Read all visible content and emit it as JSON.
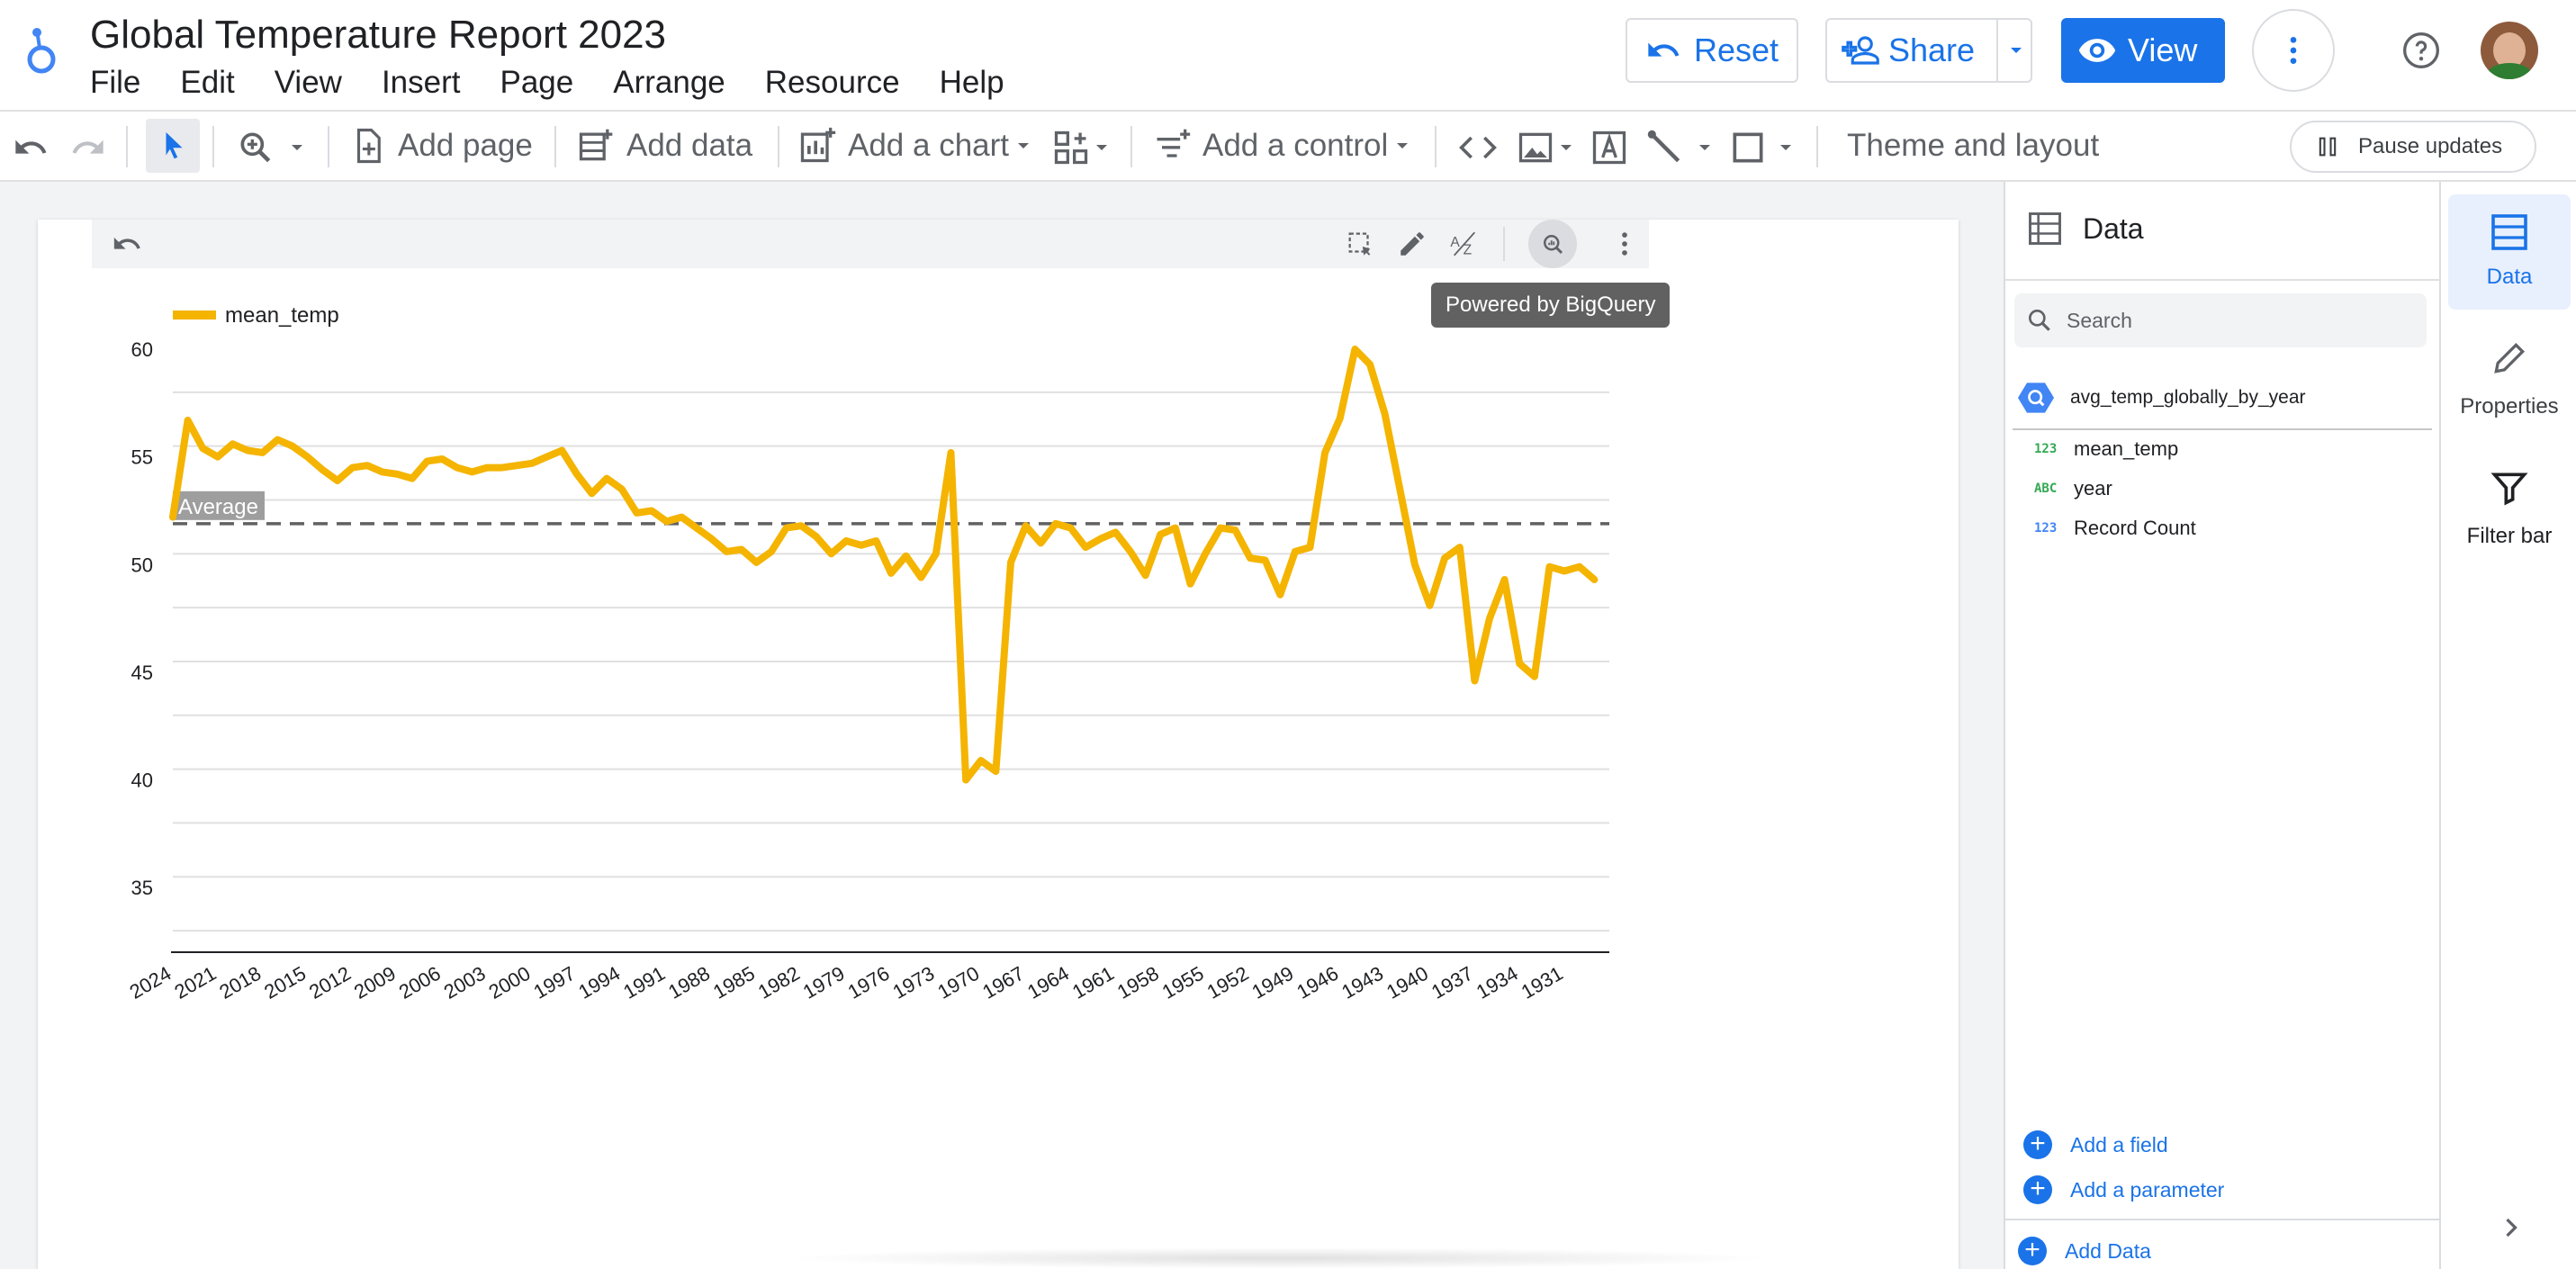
{
  "app": {
    "title": "Global Temperature Report 2023"
  },
  "menu": [
    "File",
    "Edit",
    "View",
    "Insert",
    "Page",
    "Arrange",
    "Resource",
    "Help"
  ],
  "header": {
    "reset_label": "Reset",
    "share_label": "Share",
    "view_label": "View"
  },
  "toolbar": {
    "add_page": "Add page",
    "add_data": "Add data",
    "add_chart": "Add a chart",
    "add_control": "Add a control",
    "theme_layout": "Theme and layout",
    "pause_updates": "Pause updates"
  },
  "tooltip": "Powered by BigQuery",
  "data_panel": {
    "title": "Data",
    "search_placeholder": "Search",
    "source": "avg_temp_globally_by_year",
    "fields": [
      {
        "type": "123",
        "name": "mean_temp",
        "type_color": "#34a853"
      },
      {
        "type": "ABC",
        "name": "year",
        "type_color": "#34a853"
      },
      {
        "type": "123",
        "name": "Record Count",
        "type_color": "#4285f4"
      }
    ],
    "add_field": "Add a field",
    "add_parameter": "Add a parameter",
    "add_data": "Add Data"
  },
  "side_tabs": {
    "data": "Data",
    "properties": "Properties",
    "filter_bar": "Filter bar"
  },
  "colors": {
    "accent": "#1a73e8",
    "series": "#f4b400",
    "reference_line": "#5f6368"
  },
  "chart_data": {
    "type": "line",
    "legend": [
      "mean_temp"
    ],
    "legend_position": "top-left",
    "ylim": [
      32,
      60
    ],
    "yticks": [
      35,
      40,
      45,
      50,
      55,
      60
    ],
    "grid": true,
    "reference_line": {
      "label": "Average",
      "value": 51.9
    },
    "x": [
      2024,
      2023,
      2022,
      2021,
      2020,
      2019,
      2018,
      2017,
      2016,
      2015,
      2014,
      2013,
      2012,
      2011,
      2010,
      2009,
      2008,
      2007,
      2006,
      2005,
      2004,
      2003,
      2002,
      2001,
      2000,
      1999,
      1998,
      1997,
      1996,
      1995,
      1994,
      1993,
      1992,
      1991,
      1990,
      1989,
      1988,
      1987,
      1986,
      1985,
      1984,
      1983,
      1982,
      1981,
      1980,
      1979,
      1978,
      1977,
      1976,
      1975,
      1974,
      1973,
      1972,
      1971,
      1970,
      1969,
      1968,
      1967,
      1966,
      1965,
      1964,
      1963,
      1962,
      1961,
      1960,
      1959,
      1958,
      1957,
      1956,
      1955,
      1954,
      1953,
      1952,
      1951,
      1950,
      1949,
      1948,
      1947,
      1946,
      1945,
      1944,
      1943,
      1942,
      1941,
      1940,
      1939,
      1938,
      1937,
      1936,
      1935,
      1934,
      1933,
      1932,
      1931,
      1930,
      1929,
      1928
    ],
    "series": [
      {
        "name": "mean_temp",
        "values": [
          52.2,
          56.7,
          55.4,
          55.0,
          55.6,
          55.3,
          55.2,
          55.8,
          55.5,
          55.0,
          54.4,
          53.9,
          54.5,
          54.6,
          54.3,
          54.2,
          54.0,
          54.8,
          54.9,
          54.5,
          54.3,
          54.5,
          54.5,
          54.6,
          54.7,
          55.0,
          55.3,
          54.2,
          53.3,
          54.0,
          53.5,
          52.4,
          52.5,
          52.0,
          52.2,
          51.7,
          51.2,
          50.6,
          50.7,
          50.1,
          50.6,
          51.7,
          51.8,
          51.3,
          50.5,
          51.1,
          50.9,
          51.1,
          49.6,
          50.4,
          49.4,
          50.5,
          55.2,
          40.0,
          40.9,
          40.4,
          50.1,
          51.8,
          51.0,
          51.9,
          51.7,
          50.8,
          51.2,
          51.5,
          50.6,
          49.5,
          51.4,
          51.7,
          49.1,
          50.5,
          51.7,
          51.6,
          50.3,
          50.2,
          48.6,
          50.6,
          50.8,
          55.2,
          56.8,
          60.0,
          59.3,
          57.0,
          53.5,
          50.0,
          48.1,
          50.3,
          50.8,
          44.6,
          47.5,
          49.3,
          45.4,
          44.8,
          49.9,
          49.7,
          49.9,
          49.3
        ]
      }
    ],
    "xtick_labels": [
      "2024",
      "2021",
      "2018",
      "2015",
      "2012",
      "2009",
      "2006",
      "2003",
      "2000",
      "1997",
      "1994",
      "1991",
      "1988",
      "1985",
      "1982",
      "1979",
      "1976",
      "1973",
      "1970",
      "1967",
      "1964",
      "1961",
      "1958",
      "1955",
      "1952",
      "1949",
      "1946",
      "1943",
      "1940",
      "1937",
      "1934",
      "1931"
    ]
  }
}
